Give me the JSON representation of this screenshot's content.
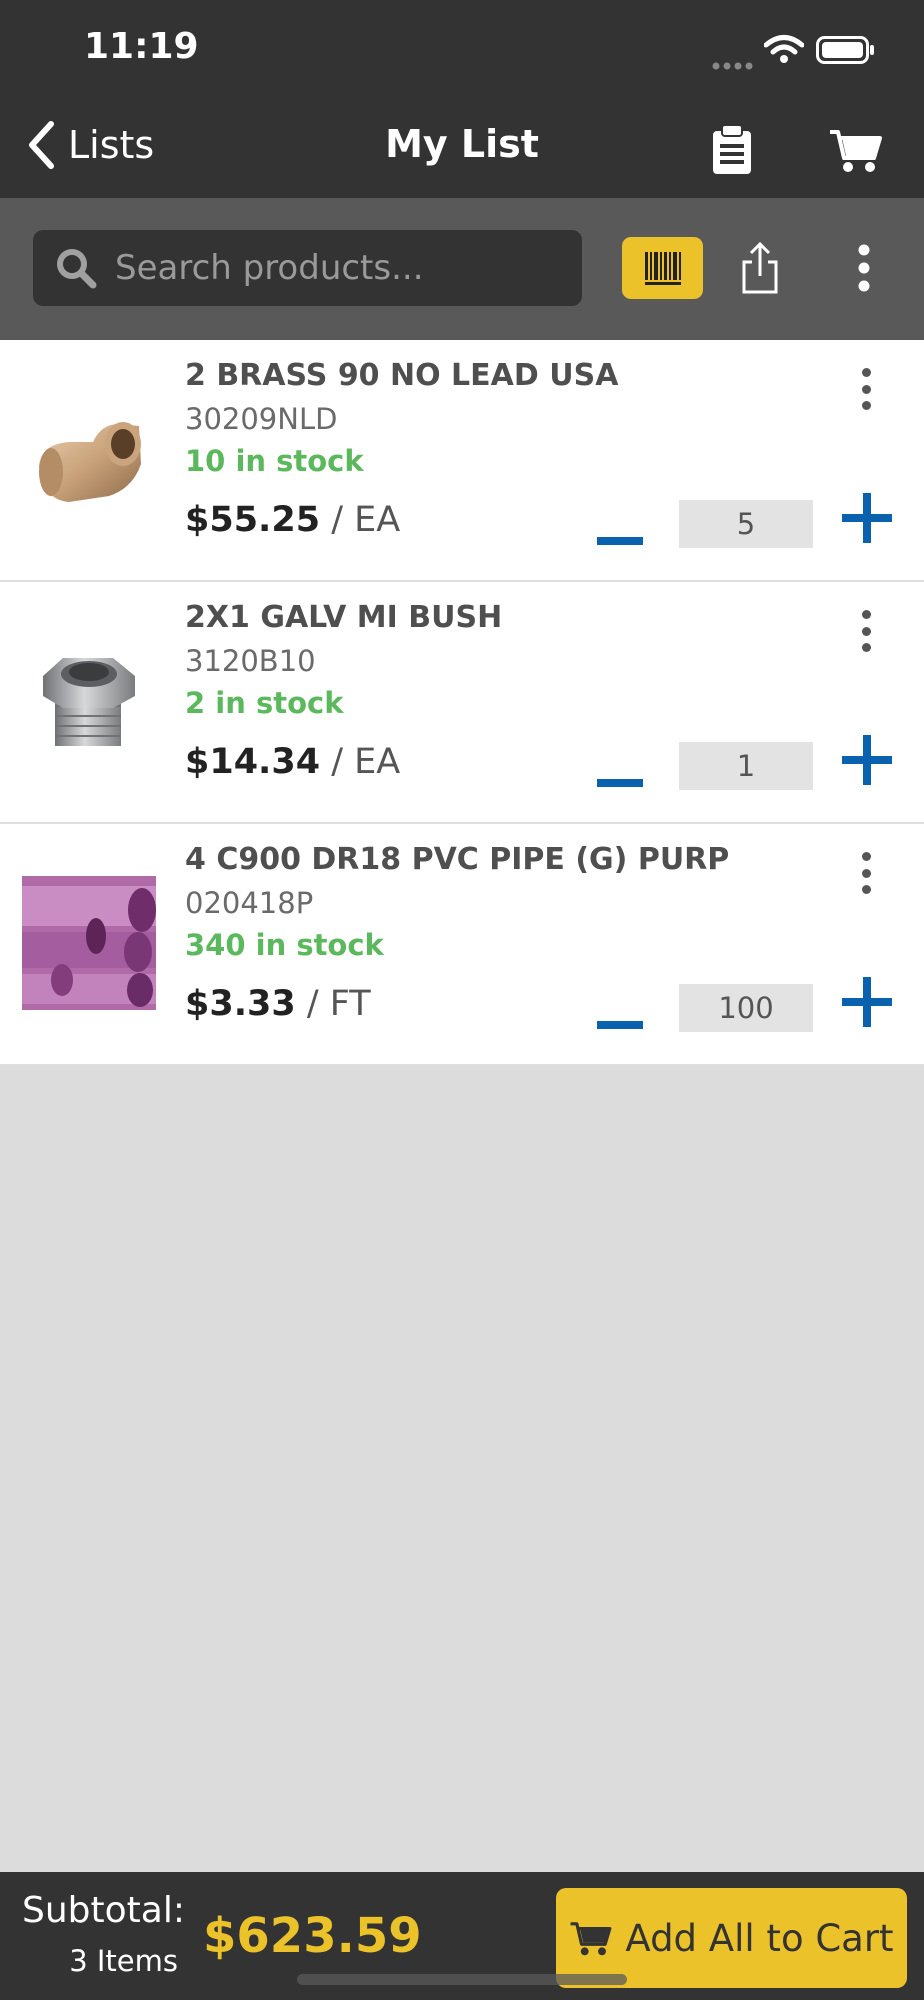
{
  "status_bar": {
    "time": "11:19"
  },
  "nav": {
    "back_label": "Lists",
    "title": "My List"
  },
  "search": {
    "placeholder": "Search products..."
  },
  "items": [
    {
      "name": "2 BRASS 90 NO LEAD USA",
      "sku": "30209NLD",
      "stock": "10 in stock",
      "price": "$55.25",
      "unit": "/ EA",
      "quantity": "5",
      "image": "brass-elbow-fitting"
    },
    {
      "name": "2X1 GALV MI BUSH",
      "sku": "3120B10",
      "stock": "2 in stock",
      "price": "$14.34",
      "unit": "/ EA",
      "quantity": "1",
      "image": "galvanized-bushing"
    },
    {
      "name": "4 C900 DR18 PVC PIPE (G) PURP",
      "sku": "020418P",
      "stock": "340 in stock",
      "price": "$3.33",
      "unit": "/ FT",
      "quantity": "100",
      "image": "purple-pvc-pipe"
    }
  ],
  "footer": {
    "subtotal_label": "Subtotal:",
    "items_count": "3 Items",
    "subtotal_value": "$623.59",
    "add_all_label": "Add All to Cart"
  },
  "colors": {
    "bar": "#333333",
    "search_band": "#595959",
    "accent": "#ecc22a",
    "stock_green": "#5cb85c",
    "stepper_blue": "#0a62ae",
    "empty_bg": "#dcdcdc"
  },
  "icons": [
    "chevron-left-icon",
    "clipboard-icon",
    "cart-icon",
    "search-icon",
    "barcode-icon",
    "share-icon",
    "more-vertical-icon",
    "minus-icon",
    "plus-icon",
    "signal-icon",
    "wifi-icon",
    "battery-icon"
  ]
}
